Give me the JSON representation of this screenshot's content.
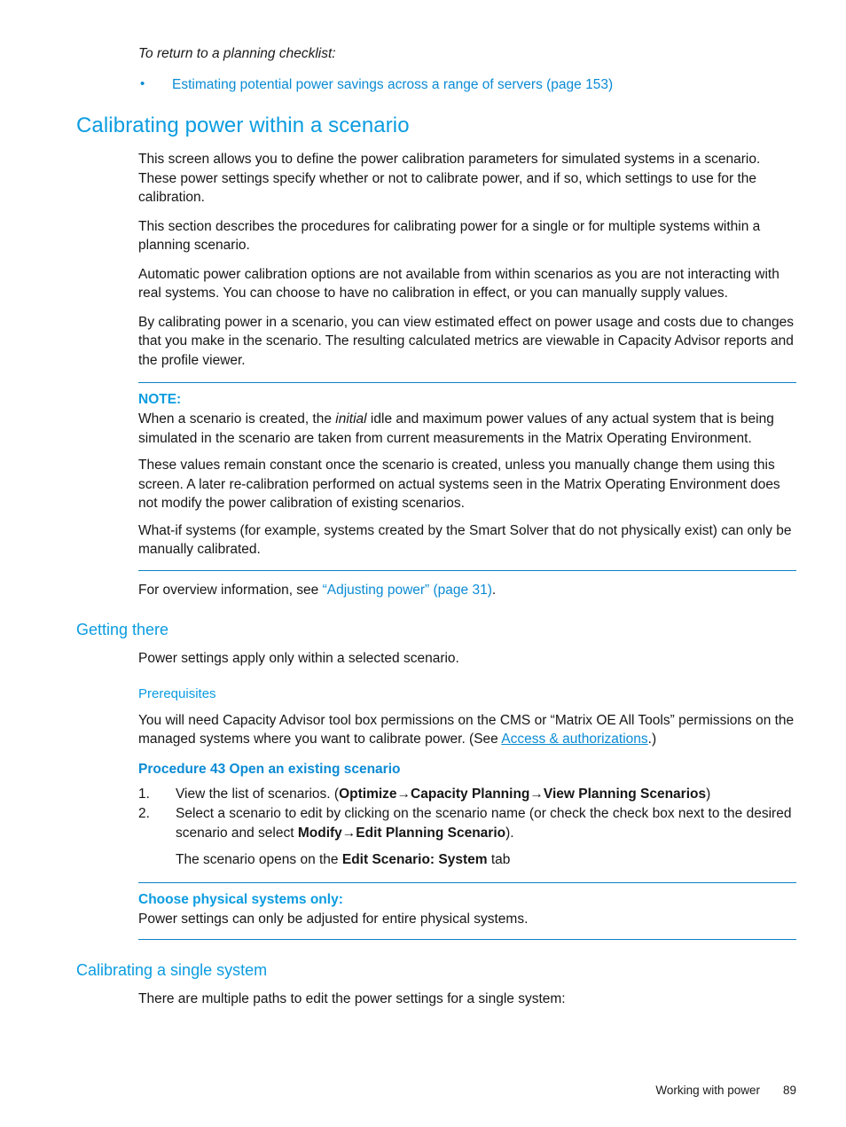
{
  "page": {
    "footer_title": "Working with power",
    "footer_page_number": "89",
    "accent_blue": "#0b9ce0",
    "link_blue": "#0b8bd4",
    "rule_blue": "#0b82c6"
  },
  "intro": {
    "lead_in": "To return to a planning checklist:",
    "bullets": [
      "Estimating potential power savings across a range of servers (page 153)"
    ]
  },
  "chapter": {
    "heading": "Calibrating power within a scenario",
    "paragraphs": [
      "This screen allows you to define the power calibration parameters for simulated systems in a scenario. These power settings specify whether or not to calibrate power, and if so, which settings to use for the calibration.",
      "This section describes the procedures for calibrating power for a single or for multiple systems within a planning scenario.",
      "Automatic power calibration options are not available from within scenarios as you are not interacting with real systems. You can choose to have no calibration in effect, or you can manually supply values.",
      "By calibrating power in a scenario, you can view estimated effect on power usage and costs due to changes that you make in the scenario. The resulting calculated metrics are viewable in Capacity Advisor reports and the profile viewer."
    ]
  },
  "note": {
    "label": "NOTE:",
    "para1_before_italic": "When a scenario is created, the ",
    "para1_italic": "initial",
    "para1_after_italic": " idle and maximum power values of any actual system that is being simulated in the scenario are taken from current measurements in the Matrix Operating Environment.",
    "para2": "These values remain constant once the scenario is created, unless you manually change them using this screen. A later re-calibration performed on actual systems seen in the Matrix Operating Environment does not modify the power calibration of existing scenarios.",
    "para3": "What-if systems (for example, systems created by the Smart Solver that do not physically exist) can only be manually calibrated."
  },
  "overview_ref": {
    "before": "For overview information, see ",
    "link": "“Adjusting power” (page 31)",
    "after": "."
  },
  "getting_there": {
    "heading": "Getting there",
    "paragraph": "Power settings apply only within a selected scenario.",
    "prerequisites_heading": "Prerequisites",
    "prereq_before_link": "You will need Capacity Advisor tool box permissions on the CMS or “Matrix OE All Tools” permissions on the managed systems where you want to calibrate power. (See ",
    "prereq_link": "Access & authorizations",
    "prereq_after_link": ".)"
  },
  "procedure": {
    "heading": "Procedure 43 Open an existing scenario",
    "steps": [
      {
        "number": "1.",
        "text_before": "View the list of scenarios. (",
        "bold_parts": [
          "Optimize",
          "Capacity Planning",
          "View Planning Scenarios"
        ],
        "text_after": ")"
      },
      {
        "number": "2.",
        "text_before": "Select a scenario to edit by clicking on the scenario name (or check the check box next to the desired scenario and select ",
        "bold_parts": [
          "Modify",
          "Edit Planning Scenario"
        ],
        "text_after": ")."
      }
    ],
    "arrow": "→",
    "followup_before": "The scenario opens on the ",
    "followup_bold": "Edit Scenario: System",
    "followup_after": " tab"
  },
  "choose_note": {
    "label": "Choose physical systems only:",
    "paragraph": "Power settings can only be adjusted for entire physical systems."
  },
  "single_system": {
    "heading": "Calibrating a single system",
    "paragraph": "There are multiple paths to edit the power settings for a single system:"
  }
}
